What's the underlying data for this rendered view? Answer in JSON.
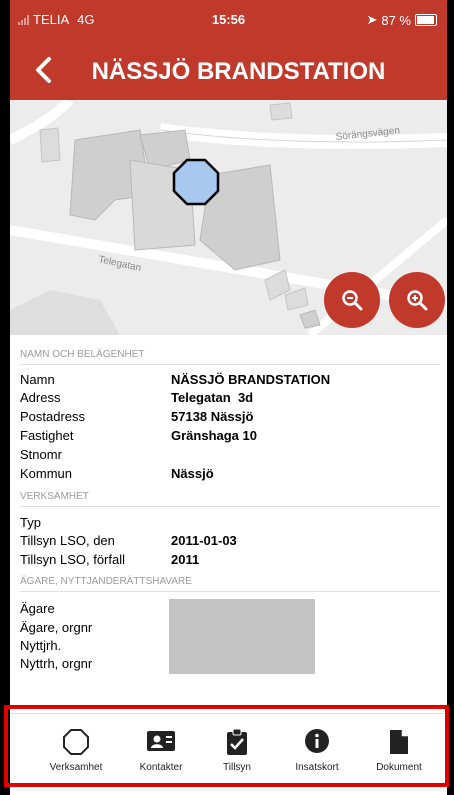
{
  "status_bar": {
    "carrier": "TELIA",
    "network": "4G",
    "time": "15:56",
    "battery": "87 %"
  },
  "header": {
    "back_icon": "chevron-left-icon",
    "title": "NÄSSJÖ BRANDSTATION"
  },
  "map": {
    "streets": [
      "Sörängsvägen",
      "Telegatan"
    ],
    "marker_color": "#a8c8f0"
  },
  "colors": {
    "accent": "#c0392b",
    "highlight_frame": "#e00000"
  },
  "section_location": {
    "heading": "NAMN och BELÄGENHET",
    "rows": [
      {
        "label": "Namn",
        "value": "NÄSSJÖ BRANDSTATION"
      },
      {
        "label": "Adress",
        "value": "Telegatan  3d"
      },
      {
        "label": "Postadress",
        "value": "57138 Nässjö"
      },
      {
        "label": "Fastighet",
        "value": "Gränshaga 10"
      },
      {
        "label": "Stnomr",
        "value": ""
      },
      {
        "label": "Kommun",
        "value": "Nässjö"
      }
    ]
  },
  "section_business": {
    "heading": "VERKSAMHET",
    "rows": [
      {
        "label": "Typ",
        "value": ""
      },
      {
        "label": "Tillsyn LSO, den",
        "value": "2011-01-03"
      },
      {
        "label": "Tillsyn LSO, förfall",
        "value": "2011"
      }
    ]
  },
  "section_owner": {
    "heading": "ÄGARE, NYTTJANDERÄTTSHAVARE",
    "rows": [
      {
        "label": "Ägare"
      },
      {
        "label": "Ägare, orgnr"
      },
      {
        "label": "Nyttjrh."
      },
      {
        "label": "Nyttrh, orgnr"
      }
    ]
  },
  "nav": [
    {
      "label": "Verksamhet",
      "icon": "octagon-icon"
    },
    {
      "label": "Kontakter",
      "icon": "contact-card-icon"
    },
    {
      "label": "Tillsyn",
      "icon": "clipboard-check-icon"
    },
    {
      "label": "Insatskort",
      "icon": "info-icon"
    },
    {
      "label": "Dokument",
      "icon": "document-icon"
    }
  ]
}
